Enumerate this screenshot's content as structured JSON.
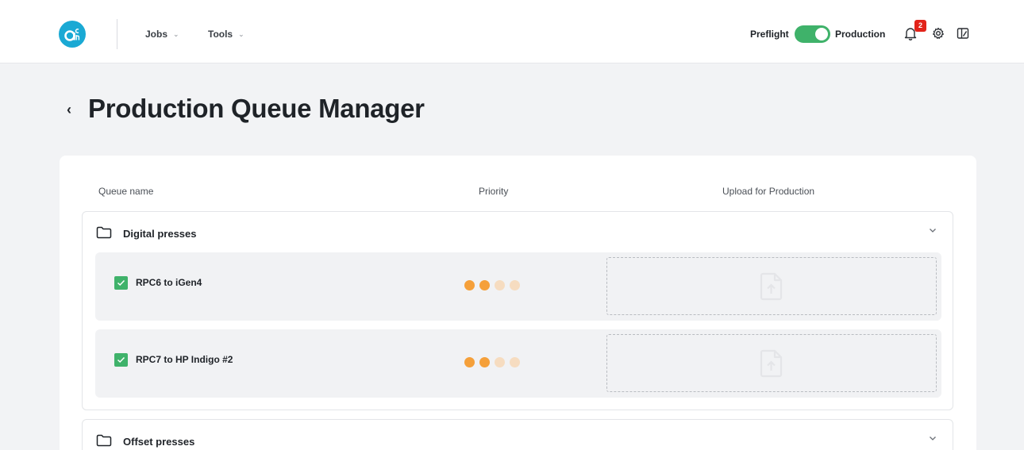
{
  "header": {
    "nav": [
      {
        "label": "Jobs",
        "chevron": "⌄"
      },
      {
        "label": "Tools",
        "chevron": "⌄"
      }
    ],
    "mode_left": "Preflight",
    "mode_right": "Production",
    "toggle_state": "Production",
    "notification_count": "2",
    "icons": [
      "app-logo-icon",
      "bell-icon",
      "gear-icon",
      "panel-icon"
    ]
  },
  "page": {
    "back_glyph": "‹",
    "title": "Production Queue Manager"
  },
  "table": {
    "columns": [
      "Queue name",
      "Priority",
      "Upload for Production"
    ],
    "groups": [
      {
        "name": "Digital presses",
        "expanded": true,
        "queues": [
          {
            "name": "RPC6 to iGen4",
            "checked": true,
            "priority": 2,
            "priority_max": 4
          },
          {
            "name": "RPC7 to HP Indigo #2",
            "checked": true,
            "priority": 2,
            "priority_max": 4
          }
        ]
      },
      {
        "name": "Offset presses",
        "expanded": false,
        "queues": []
      }
    ]
  },
  "colors": {
    "accent_green": "#3fb26a",
    "priority_on": "#f5a03a",
    "priority_off": "#f6dcc0",
    "badge_red": "#e2231a",
    "logo_blue": "#1aa9d4"
  }
}
